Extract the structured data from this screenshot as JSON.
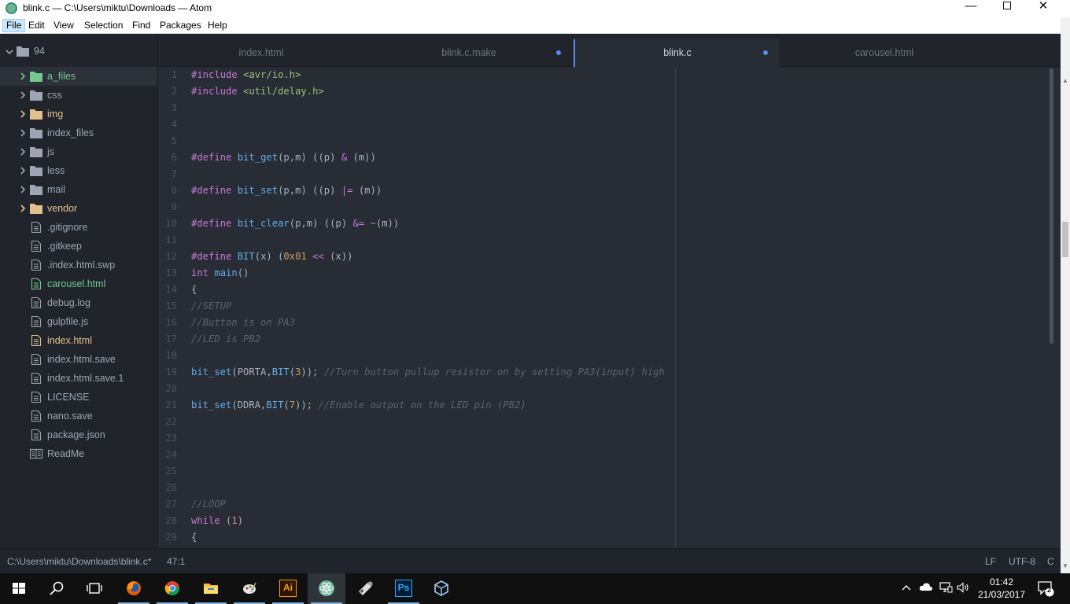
{
  "window": {
    "title": "blink.c — C:\\Users\\miktu\\Downloads — Atom",
    "minimize_glyph": "—",
    "close_glyph": "✕"
  },
  "menu": [
    "File",
    "Edit",
    "View",
    "Selection",
    "Find",
    "Packages",
    "Help"
  ],
  "tree": {
    "root": "94",
    "items": [
      {
        "label": "a_files",
        "type": "folder",
        "status": "added",
        "selected": true
      },
      {
        "label": "css",
        "type": "folder",
        "status": "none"
      },
      {
        "label": "img",
        "type": "folder",
        "status": "modified"
      },
      {
        "label": "index_files",
        "type": "folder",
        "status": "none"
      },
      {
        "label": "js",
        "type": "folder",
        "status": "none"
      },
      {
        "label": "less",
        "type": "folder",
        "status": "none"
      },
      {
        "label": "mail",
        "type": "folder",
        "status": "none"
      },
      {
        "label": "vendor",
        "type": "folder",
        "status": "modified"
      },
      {
        "label": ".gitignore",
        "type": "file",
        "status": "none"
      },
      {
        "label": ".gitkeep",
        "type": "file",
        "status": "none"
      },
      {
        "label": ".index.html.swp",
        "type": "file",
        "status": "none"
      },
      {
        "label": "carousel.html",
        "type": "file",
        "status": "added"
      },
      {
        "label": "debug.log",
        "type": "file",
        "status": "none"
      },
      {
        "label": "gulpfile.js",
        "type": "file",
        "status": "none"
      },
      {
        "label": "index.html",
        "type": "file",
        "status": "modified"
      },
      {
        "label": "index.html.save",
        "type": "file",
        "status": "none"
      },
      {
        "label": "index.html.save.1",
        "type": "file",
        "status": "none"
      },
      {
        "label": "LICENSE",
        "type": "file",
        "status": "none"
      },
      {
        "label": "nano.save",
        "type": "file",
        "status": "none"
      },
      {
        "label": "package.json",
        "type": "file",
        "status": "none"
      },
      {
        "label": "ReadMe",
        "type": "book",
        "status": "none"
      }
    ]
  },
  "tabs": [
    {
      "label": "index.html",
      "modified": false,
      "active": false
    },
    {
      "label": "blink.c.make",
      "modified": true,
      "active": false
    },
    {
      "label": "blink.c",
      "modified": true,
      "active": true
    },
    {
      "label": "carousel.html",
      "modified": false,
      "active": false
    }
  ],
  "code_lines": [
    {
      "n": "1",
      "t": [
        [
          "k",
          "#include"
        ],
        [
          "p",
          " "
        ],
        [
          "s",
          "<avr/io.h>"
        ]
      ]
    },
    {
      "n": "2",
      "t": [
        [
          "k",
          "#include"
        ],
        [
          "p",
          " "
        ],
        [
          "s",
          "<util/delay.h>"
        ]
      ]
    },
    {
      "n": "3",
      "t": []
    },
    {
      "n": "4",
      "t": []
    },
    {
      "n": "5",
      "t": []
    },
    {
      "n": "6",
      "t": [
        [
          "k",
          "#define"
        ],
        [
          "p",
          " "
        ],
        [
          "f",
          "bit_get"
        ],
        [
          "p",
          "(p,m) ((p) "
        ],
        [
          "o",
          "&"
        ],
        [
          "p",
          " (m))"
        ]
      ]
    },
    {
      "n": "7",
      "t": []
    },
    {
      "n": "8",
      "t": [
        [
          "k",
          "#define"
        ],
        [
          "p",
          " "
        ],
        [
          "f",
          "bit_set"
        ],
        [
          "p",
          "(p,m) ((p) "
        ],
        [
          "o",
          "|="
        ],
        [
          "p",
          " (m))"
        ]
      ]
    },
    {
      "n": "9",
      "t": []
    },
    {
      "n": "10",
      "t": [
        [
          "k",
          "#define"
        ],
        [
          "p",
          " "
        ],
        [
          "f",
          "bit_clear"
        ],
        [
          "p",
          "(p,m) ((p) "
        ],
        [
          "o",
          "&="
        ],
        [
          "p",
          " "
        ],
        [
          "o",
          "~"
        ],
        [
          "p",
          "(m))"
        ]
      ]
    },
    {
      "n": "11",
      "t": []
    },
    {
      "n": "12",
      "t": [
        [
          "k",
          "#define"
        ],
        [
          "p",
          " "
        ],
        [
          "f",
          "BIT"
        ],
        [
          "p",
          "(x) ("
        ],
        [
          "n",
          "0x01"
        ],
        [
          "p",
          " "
        ],
        [
          "o",
          "<<"
        ],
        [
          "p",
          " (x))"
        ]
      ]
    },
    {
      "n": "13",
      "t": [
        [
          "k",
          "int"
        ],
        [
          "p",
          " "
        ],
        [
          "f",
          "main"
        ],
        [
          "p",
          "()"
        ]
      ]
    },
    {
      "n": "14",
      "t": [
        [
          "p",
          "{"
        ]
      ]
    },
    {
      "n": "15",
      "t": [
        [
          "cm",
          "//SETUP"
        ]
      ]
    },
    {
      "n": "16",
      "t": [
        [
          "cm",
          "//Button is on PA3"
        ]
      ]
    },
    {
      "n": "17",
      "t": [
        [
          "cm",
          "//LED is PB2"
        ]
      ]
    },
    {
      "n": "18",
      "t": []
    },
    {
      "n": "19",
      "t": [
        [
          "f",
          "bit_set"
        ],
        [
          "p",
          "(PORTA,"
        ],
        [
          "f",
          "BIT"
        ],
        [
          "p",
          "("
        ],
        [
          "n",
          "3"
        ],
        [
          "p",
          ")); "
        ],
        [
          "cm",
          "//Turn button pullup resistor on by setting PA3(input) high"
        ]
      ]
    },
    {
      "n": "20",
      "t": []
    },
    {
      "n": "21",
      "t": [
        [
          "f",
          "bit_set"
        ],
        [
          "p",
          "(DDRA,"
        ],
        [
          "f",
          "BIT"
        ],
        [
          "p",
          "("
        ],
        [
          "n",
          "7"
        ],
        [
          "p",
          ")); "
        ],
        [
          "cm",
          "//Enable output on the LED pin (PB2)"
        ]
      ]
    },
    {
      "n": "22",
      "t": []
    },
    {
      "n": "23",
      "t": []
    },
    {
      "n": "24",
      "t": []
    },
    {
      "n": "25",
      "t": []
    },
    {
      "n": "26",
      "t": []
    },
    {
      "n": "27",
      "t": [
        [
          "cm",
          "//LOOP"
        ]
      ]
    },
    {
      "n": "28",
      "t": [
        [
          "k",
          "while"
        ],
        [
          "p",
          " ("
        ],
        [
          "n",
          "1"
        ],
        [
          "p",
          ")"
        ]
      ]
    },
    {
      "n": "29",
      "t": [
        [
          "p",
          "{"
        ]
      ]
    }
  ],
  "status": {
    "path": "C:\\Users\\miktu\\Downloads\\blink.c*",
    "cursor": "47:1",
    "line_ending": "LF",
    "encoding": "UTF-8",
    "grammar": "C"
  },
  "taskbar": {
    "apps": [
      "start-icon",
      "search-icon",
      "task-view-icon",
      "firefox-icon",
      "chrome-icon",
      "file-explorer-icon",
      "paint-icon",
      "illustrator-icon",
      "atom-icon",
      "usb-icon",
      "photoshop-icon",
      "virtualbox-icon"
    ],
    "time": "01:42",
    "date": "21/03/2017",
    "notifications": "2",
    "ai_label": "Ai",
    "ps_label": "Ps"
  },
  "colors": {
    "accent": "#568af2",
    "added": "#73c990",
    "modified": "#e2c08d"
  }
}
